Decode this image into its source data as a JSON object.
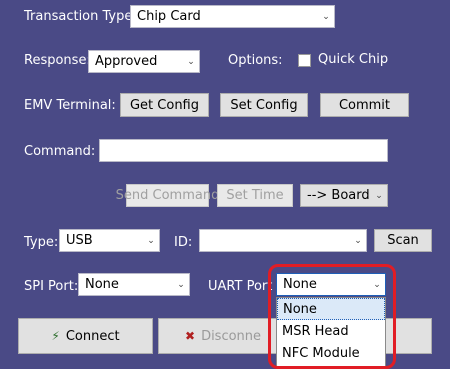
{
  "transaction": {
    "label": "Transaction Type:",
    "value": "Chip Card"
  },
  "response": {
    "label": "Response:",
    "value": "Approved"
  },
  "options": {
    "label": "Options:",
    "quick_chip": "Quick Chip"
  },
  "emv": {
    "label": "EMV Terminal:",
    "get_config": "Get Config",
    "set_config": "Set Config",
    "commit": "Commit"
  },
  "command": {
    "label": "Command:",
    "value": ""
  },
  "actions": {
    "send_command": "Send Command",
    "set_time": "Set Time",
    "board": "--> Board"
  },
  "type": {
    "label": "Type:",
    "value": "USB"
  },
  "id": {
    "label": "ID:",
    "value": "",
    "scan": "Scan"
  },
  "spi": {
    "label": "SPI Port:",
    "value": "None"
  },
  "uart": {
    "label": "UART Port",
    "value": "None",
    "options": [
      "None",
      "MSR Head",
      "NFC Module"
    ]
  },
  "buttons": {
    "connect": "Connect",
    "disconnect": "Disconne"
  },
  "colors": {
    "background": "#4a4a86",
    "highlight": "#e11d25",
    "selection": "#dbe9f8"
  }
}
